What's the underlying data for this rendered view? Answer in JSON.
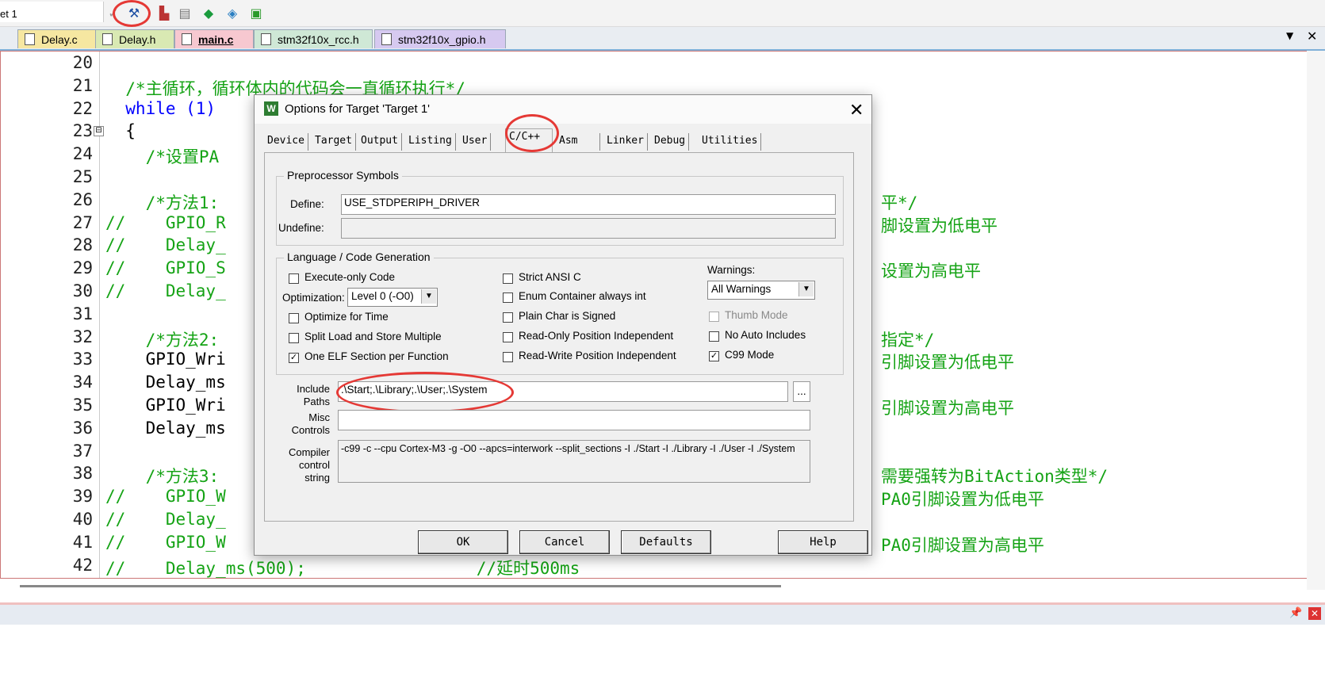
{
  "toolbar": {
    "target": "et 1"
  },
  "tabs": [
    {
      "label": "Delay.c",
      "color": "#f6e7a1"
    },
    {
      "label": "Delay.h",
      "color": "#d9e9b3"
    },
    {
      "label": "main.c",
      "color": "#f7c8d0"
    },
    {
      "label": "stm32f10x_rcc.h",
      "color": "#cfe8d6"
    },
    {
      "label": "stm32f10x_gpio.h",
      "color": "#d6c9f0"
    }
  ],
  "tabbar_controls": {
    "dropdown": "▼",
    "close": "✕"
  },
  "editor": {
    "line_numbers": [
      "20",
      "21",
      "22",
      "23",
      "24",
      "25",
      "26",
      "27",
      "28",
      "29",
      "30",
      "31",
      "32",
      "33",
      "34",
      "35",
      "36",
      "37",
      "38",
      "39",
      "40",
      "41",
      "42"
    ],
    "lines": [
      "",
      "  /*主循环，循环体内的代码会一直循环执行*/",
      "  while (1)",
      "  {",
      "    /*设置PA",
      "",
      "    /*方法1:",
      "//    GPIO_R",
      "//    Delay_",
      "//    GPIO_S",
      "//    Delay_",
      "",
      "    /*方法2:",
      "    GPIO_Wri",
      "    Delay_ms",
      "    GPIO_Wri",
      "    Delay_ms",
      "",
      "    /*方法3:",
      "//    GPIO_W",
      "//    Delay_",
      "//    GPIO_W",
      "//    Delay_ms(500);                 //延时500ms"
    ],
    "right_fragments": [
      {
        "line": 26,
        "text": "平*/"
      },
      {
        "line": 27,
        "text": "脚设置为低电平"
      },
      {
        "line": 29,
        "text": "设置为高电平"
      },
      {
        "line": 32,
        "text": "指定*/"
      },
      {
        "line": 33,
        "text": "引脚设置为低电平"
      },
      {
        "line": 35,
        "text": "引脚设置为高电平"
      },
      {
        "line": 38,
        "text": "需要强转为BitAction类型*/"
      },
      {
        "line": 39,
        "text": "PA0引脚设置为低电平"
      },
      {
        "line": 41,
        "text": "PA0引脚设置为高电平"
      }
    ]
  },
  "dialog": {
    "title": "Options for Target 'Target 1'",
    "icon_letter": "W",
    "close": "✕",
    "tabs": [
      "Device",
      "Target",
      "Output",
      "Listing",
      "User",
      "C/C++",
      "Asm",
      "Linker",
      "Debug",
      "Utilities"
    ],
    "active_tab": "C/C++",
    "preprocessor": {
      "group": "Preprocessor Symbols",
      "define_label": "Define:",
      "define_value": "USE_STDPERIPH_DRIVER",
      "undefine_label": "Undefine:",
      "undefine_value": ""
    },
    "language": {
      "group": "Language / Code Generation",
      "execute_only": "Execute-only Code",
      "optimization_label": "Optimization:",
      "optimization_value": "Level 0 (-O0)",
      "optimize_time": "Optimize for Time",
      "split_load": "Split Load and Store Multiple",
      "one_elf": "One ELF Section per Function",
      "strict_ansi": "Strict ANSI C",
      "enum_container": "Enum Container always int",
      "plain_char": "Plain Char is Signed",
      "ro_pi": "Read-Only Position Independent",
      "rw_pi": "Read-Write Position Independent",
      "warnings_label": "Warnings:",
      "warnings_value": "All Warnings",
      "thumb_mode": "Thumb Mode",
      "no_auto_includes": "No Auto Includes",
      "c99_mode": "C99 Mode",
      "check": "✓"
    },
    "include": {
      "label_l1": "Include",
      "label_l2": "Paths",
      "value": ".\\Start;.\\Library;.\\User;.\\System",
      "browse": "..."
    },
    "misc": {
      "label_l1": "Misc",
      "label_l2": "Controls",
      "value": ""
    },
    "compiler": {
      "label_l1": "Compiler",
      "label_l2": "control",
      "label_l3": "string",
      "value": "-c99 -c --cpu Cortex-M3 -g -O0 --apcs=interwork --split_sections -I ./Start -I ./Library -I ./User -I ./System"
    },
    "buttons": {
      "ok": "OK",
      "cancel": "Cancel",
      "defaults": "Defaults",
      "help": "Help"
    }
  },
  "bottom_panel": {
    "pin": "📌",
    "close": "✕"
  }
}
